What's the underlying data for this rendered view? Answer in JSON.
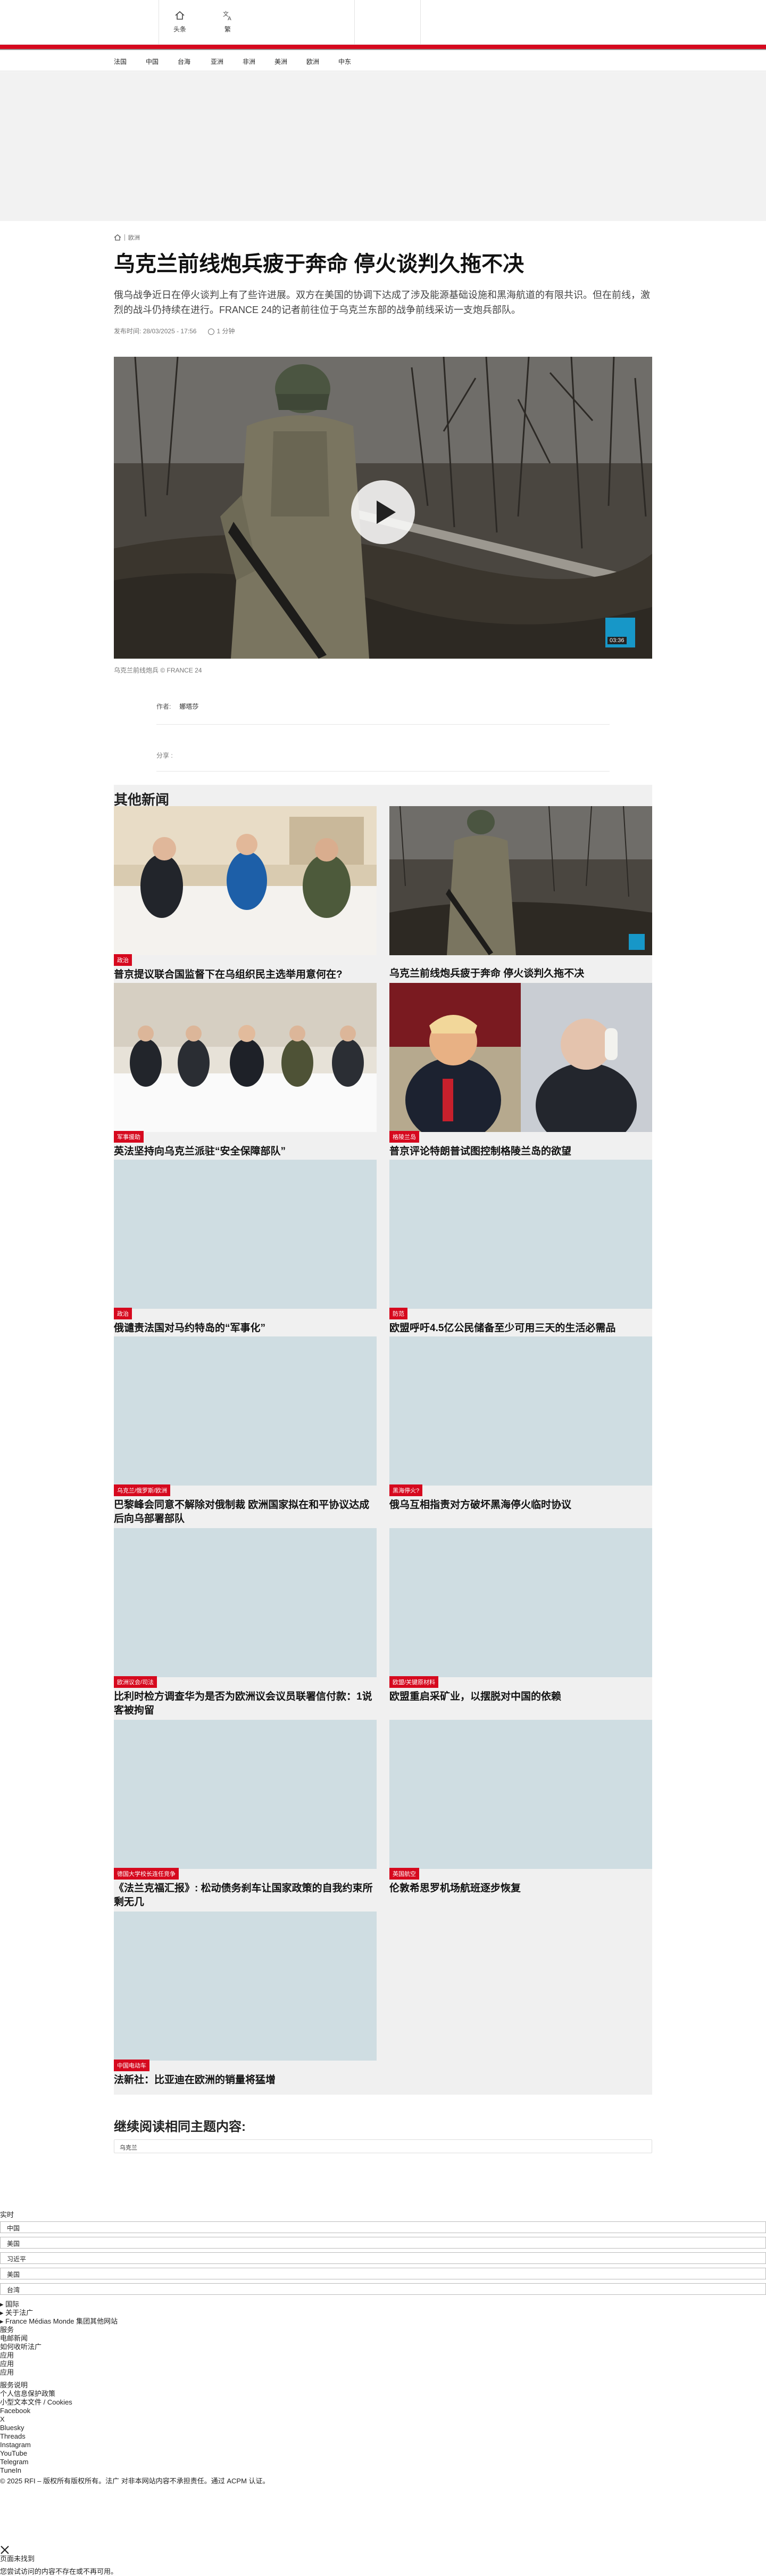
{
  "topbar": {
    "items": [
      {
        "label": "头条",
        "icon": "home-icon"
      },
      {
        "label": "繁",
        "icon": "translate-icon"
      }
    ]
  },
  "region_nav": [
    "法国",
    "中国",
    "台海",
    "亚洲",
    "非洲",
    "美洲",
    "欧洲",
    "中东"
  ],
  "article": {
    "breadcrumb": "欧洲",
    "title": "乌克兰前线炮兵疲于奔命 停火谈判久拖不决",
    "lede": "俄乌战争近日在停火谈判上有了些许进展。双方在美国的协调下达成了涉及能源基础设施和黑海航道的有限共识。但在前线，激烈的战斗仍持续在进行。FRANCE 24的记者前往位于乌克兰东部的战争前线采访一支炮兵部队。",
    "published_label": "发布时间:",
    "published": "28/03/2025 - 17:56",
    "read_time": "1 分钟",
    "video_duration": "03:36",
    "caption": "乌克兰前线炮兵 © FRANCE 24",
    "author_label": "作者:",
    "author": "娜塔莎",
    "share_label": "分享 :"
  },
  "other_news": {
    "heading": "其他新闻",
    "cards": [
      {
        "tag": "政治",
        "title": "普京提议联合国监督下在乌组织民主选举用意何在?"
      },
      {
        "tag": "",
        "title": "乌克兰前线炮兵疲于奔命 停火谈判久拖不决"
      },
      {
        "tag": "军事援助",
        "title": "英法坚持向乌克兰派驻“安全保障部队”"
      },
      {
        "tag": "格陵兰岛",
        "title": "普京评论特朗普试图控制格陵兰岛的欲望"
      },
      {
        "tag": "政治",
        "title": "俄谴责法国对马约特岛的“军事化”"
      },
      {
        "tag": "防范",
        "title": "欧盟呼吁4.5亿公民储备至少可用三天的生活必需品"
      },
      {
        "tag": "乌克兰/俄罗斯/欧洲",
        "title": "巴黎峰会同意不解除对俄制裁 欧洲国家拟在和平协议达成后向乌部署部队"
      },
      {
        "tag": "黑海停火?",
        "title": "俄乌互相指责对方破坏黑海停火临时协议"
      },
      {
        "tag": "欧洲议会/司法",
        "title": "比利时检方调查华为是否为欧洲议会议员联署信付款：1说客被拘留"
      },
      {
        "tag": "欧盟/关键原材料",
        "title": "欧盟重启采矿业，以摆脱对中国的依赖"
      },
      {
        "tag": "德国大学校长连任竞争",
        "title": "《法兰克福汇报》: 松动债务刹车让国家政策的自我约束所剩无几"
      },
      {
        "tag": "英国航空",
        "title": "伦敦希思罗机场航班逐步恢复"
      },
      {
        "tag": "中国电动车",
        "title": "法新社：比亚迪在欧洲的销量将猛增"
      }
    ]
  },
  "continue": {
    "heading": "继续阅读相同主题内容:",
    "topic": "乌克兰"
  },
  "footer": {
    "realtime_label": "实时",
    "filters": [
      "中国",
      "美国",
      "习近平",
      "美国",
      "台湾"
    ],
    "international": "▸ 国际",
    "about": "▸ 关于法广",
    "group": "▸ France Médias Monde 集团其他网站",
    "services_label": "服务",
    "services": [
      "电邮新闻",
      "如何收听法广",
      "应用",
      "应用",
      "应用"
    ],
    "legal_label": "服务说明",
    "legal": [
      "个人信息保护政策",
      "小型文本文件 / Cookies"
    ],
    "social": [
      "Facebook",
      "X",
      "Bluesky",
      "Threads",
      "Instagram",
      "YouTube",
      "Telegram",
      "TuneIn"
    ],
    "copyright": "© 2025 RFI – 版权所有版权所有。法广 对非本网站内容不承担责任。通过 ACPM 认证。",
    "page_not_found": "页面未找到",
    "page_not_found_desc": "您尝试访问的内容不存在或不再可用。"
  },
  "colors": {
    "brand_red": "#d6091e",
    "tag_red": "#d6091e",
    "thumb_placeholder": "#cfdde2"
  }
}
